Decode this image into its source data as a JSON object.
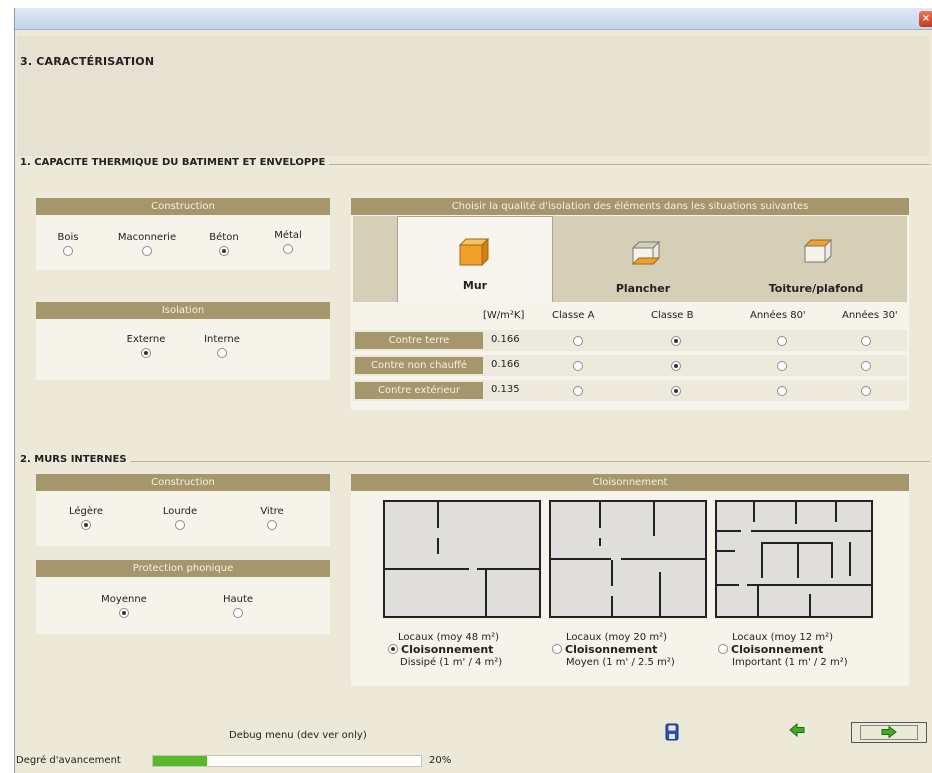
{
  "window": {
    "close_glyph": "×"
  },
  "step_title": "3.  CARACTÉRISATION",
  "section1": {
    "title": "1. CAPACITE THERMIQUE DU BATIMENT ET ENVELOPPE",
    "construction": {
      "header": "Construction",
      "options": [
        {
          "label": "Bois",
          "selected": false
        },
        {
          "label": "Maconnerie",
          "selected": false
        },
        {
          "label": "Béton",
          "selected": true
        },
        {
          "label": "Métal",
          "selected": false
        }
      ]
    },
    "isolation": {
      "header": "Isolation",
      "options": [
        {
          "label": "Externe",
          "selected": true
        },
        {
          "label": "Interne",
          "selected": false
        }
      ]
    },
    "insulation_quality": {
      "header": "Choisir la qualité d'isolation des éléments dans les situations suivantes",
      "tabs": [
        {
          "label": "Mur",
          "icon": "wall-icon",
          "active": true
        },
        {
          "label": "Plancher",
          "icon": "floor-icon",
          "active": false
        },
        {
          "label": "Toiture/plafond",
          "icon": "roof-icon",
          "active": false
        }
      ],
      "columns": [
        "[W/m²K]",
        "Classe A",
        "Classe B",
        "Années 80'",
        "Années 30'"
      ],
      "rows": [
        {
          "label": "Contre terre",
          "value": "0.166",
          "selected_index": 1
        },
        {
          "label": "Contre non chauffé",
          "value": "0.166",
          "selected_index": 1
        },
        {
          "label": "Contre extérieur",
          "value": "0.135",
          "selected_index": 1
        }
      ]
    }
  },
  "section2": {
    "title": "2. MURS INTERNES",
    "construction": {
      "header": "Construction",
      "options": [
        {
          "label": "Légère",
          "selected": true
        },
        {
          "label": "Lourde",
          "selected": false
        },
        {
          "label": "Vitre",
          "selected": false
        }
      ]
    },
    "protection": {
      "header": "Protection phonique",
      "options": [
        {
          "label": "Moyenne",
          "selected": true
        },
        {
          "label": "Haute",
          "selected": false
        }
      ]
    },
    "cloisonnement": {
      "header": "Cloisonnement",
      "options": [
        {
          "line1": "Locaux (moy 48 m²)",
          "line2": "Cloisonnement",
          "line3": "Dissipé (1 m' / 4 m²)",
          "selected": true
        },
        {
          "line1": "Locaux (moy 20 m²)",
          "line2": "Cloisonnement",
          "line3": "Moyen  (1 m' / 2.5 m²)",
          "selected": false
        },
        {
          "line1": "Locaux (moy 12 m²)",
          "line2": "Cloisonnement",
          "line3": "Important  (1 m' / 2 m²)",
          "selected": false
        }
      ]
    }
  },
  "footer": {
    "debug_label": "Debug menu (dev ver only)",
    "save_icon": "save-icon",
    "back_icon": "arrow-left-icon",
    "next_icon": "arrow-right-icon",
    "progress_label": "Degré d'avancement",
    "progress_fraction": 0.2,
    "progress_text": "20%"
  },
  "colors": {
    "group_header": "#a5966b",
    "progress_fill": "#58b92a",
    "background": "#ece9d8"
  }
}
